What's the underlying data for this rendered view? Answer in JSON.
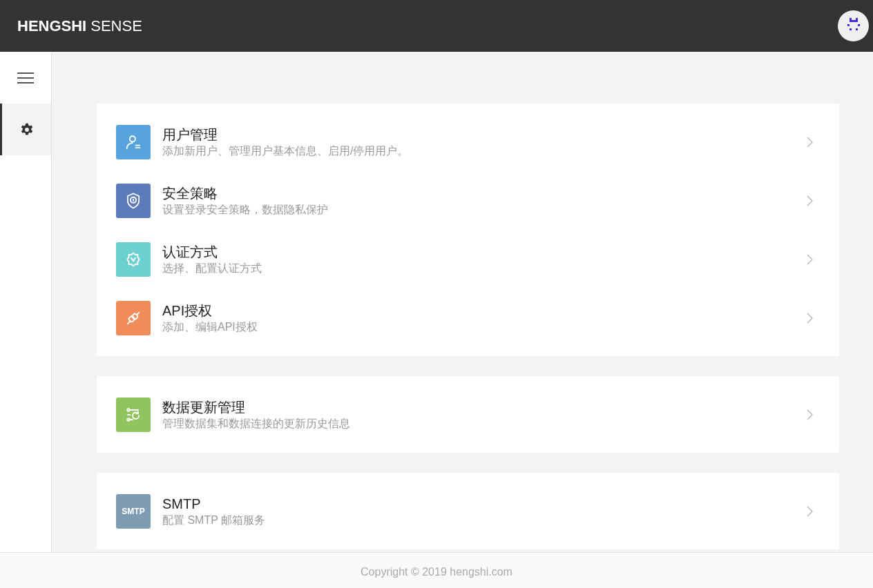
{
  "header": {
    "brand_bold": "HENGSHI",
    "brand_light": "SENSE"
  },
  "sidebar": {
    "items": [
      {
        "kind": "menu",
        "selected": false
      },
      {
        "kind": "settings",
        "selected": true
      }
    ]
  },
  "groups": [
    {
      "items": [
        {
          "kind": "user",
          "color": "#57a3dd",
          "title": "用户管理",
          "description": "添加新用户、管理用户基本信息、启用/停用用户。"
        },
        {
          "kind": "shield",
          "color": "#5b7bbd",
          "title": "安全策略",
          "description": "设置登录安全策略，数据隐私保护"
        },
        {
          "kind": "badge",
          "color": "#6dd0d0",
          "title": "认证方式",
          "description": "选择、配置认证方式"
        },
        {
          "kind": "plug",
          "color": "#ef8c5a",
          "title": "API授权",
          "description": "添加、编辑API授权"
        }
      ]
    },
    {
      "items": [
        {
          "kind": "refresh",
          "color": "#8fc45e",
          "title": "数据更新管理",
          "description": "管理数据集和数据连接的更新历史信息"
        }
      ]
    },
    {
      "items": [
        {
          "kind": "text",
          "color": "#7e9db3",
          "icon_text": "SMTP",
          "title": "SMTP",
          "description": "配置 SMTP 邮箱服务"
        }
      ]
    }
  ],
  "footer": {
    "copyright": "Copyright © 2019 hengshi.com"
  }
}
